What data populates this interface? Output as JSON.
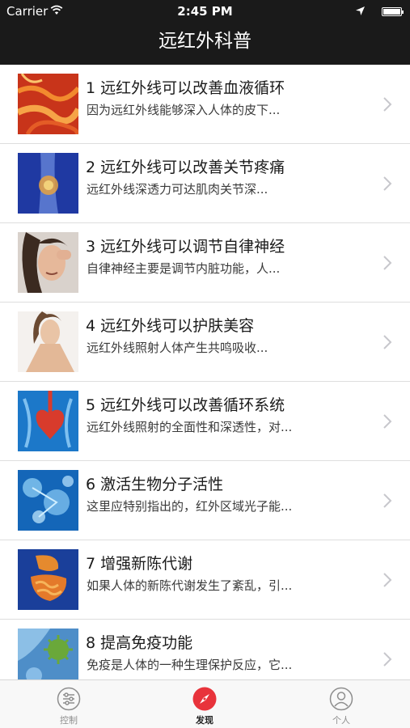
{
  "status_bar": {
    "carrier": "Carrier",
    "time": "2:45 PM"
  },
  "header": {
    "title": "远红外科普"
  },
  "articles": [
    {
      "title": "1 远红外线可以改善血液循环",
      "summary": "因为远红外线能够深入人体的皮下...",
      "thumb_icon": "blood-vessels-image"
    },
    {
      "title": "2 远红外线可以改善关节疼痛",
      "summary": "远红外线深透力可达肌肉关节深...",
      "thumb_icon": "knee-joint-image"
    },
    {
      "title": "3 远红外线可以调节自律神经",
      "summary": "自律神经主要是调节内脏功能，人...",
      "thumb_icon": "headache-woman-image"
    },
    {
      "title": "4 远红外线可以护肤美容",
      "summary": "远红外线照射人体产生共鸣吸收...",
      "thumb_icon": "skincare-woman-image"
    },
    {
      "title": "5 远红外线可以改善循环系统",
      "summary": "远红外线照射的全面性和深透性，对...",
      "thumb_icon": "heart-anatomy-image"
    },
    {
      "title": "6 激活生物分子活性",
      "summary": "这里应特别指出的，红外区域光子能...",
      "thumb_icon": "molecules-image"
    },
    {
      "title": "7 增强新陈代谢",
      "summary": "如果人体的新陈代谢发生了紊乱，引...",
      "thumb_icon": "digestive-system-image"
    },
    {
      "title": "8 提高免疫功能",
      "summary": "免疫是人体的一种生理保护反应，它...",
      "thumb_icon": "immune-virus-image"
    }
  ],
  "tabbar": {
    "tabs": [
      {
        "label": "控制",
        "icon": "sliders-icon"
      },
      {
        "label": "发现",
        "icon": "compass-icon",
        "active": true
      },
      {
        "label": "个人",
        "icon": "user-icon"
      }
    ]
  },
  "colors": {
    "header_bg": "#1a1a1a",
    "accent": "#e8333b",
    "divider": "#dedede"
  }
}
